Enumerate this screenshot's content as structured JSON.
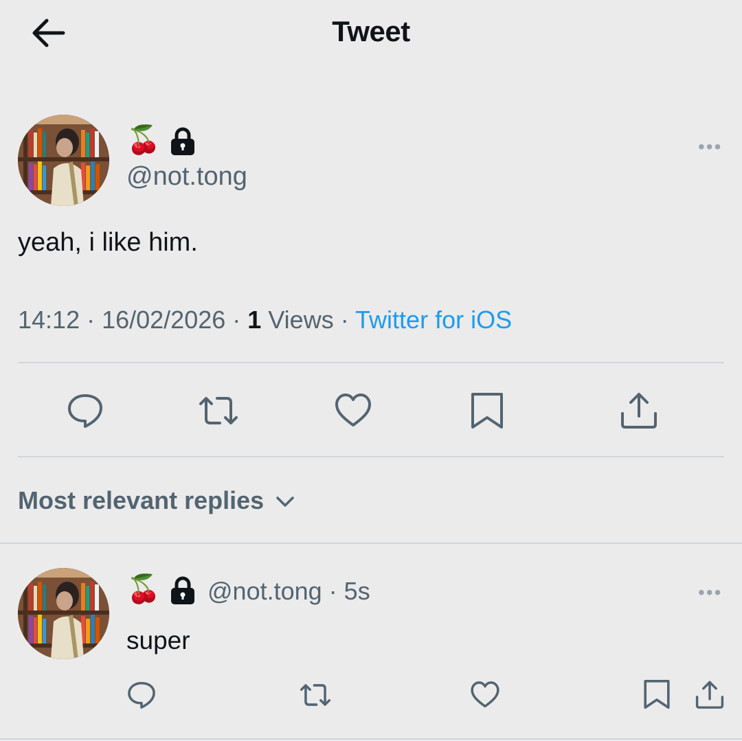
{
  "header": {
    "title": "Tweet",
    "back_icon": "arrow-left-icon"
  },
  "tweet": {
    "author_emoji": "🍒",
    "lock_icon": "lock-icon",
    "handle": "@not.tong",
    "text": "yeah, i like him.",
    "time": "14:12",
    "sep1": " · ",
    "date": "16/02/2026",
    "sep2": " · ",
    "views_count": "1",
    "views_label": " Views",
    "sep3": " · ",
    "source": "Twitter for iOS",
    "more_label": "•••"
  },
  "actions": [
    "reply-icon",
    "retweet-icon",
    "like-icon",
    "bookmark-icon",
    "share-icon"
  ],
  "replies_sort": {
    "label": "Most relevant replies",
    "icon": "chevron-down-icon"
  },
  "reply": {
    "author_emoji": "🍒",
    "handle": "@not.tong",
    "sep": " · ",
    "time": "5s",
    "text": "super",
    "more_label": "•••"
  },
  "colors": {
    "background": "#ebebeb",
    "text": "#0f1419",
    "secondary": "#536471",
    "link": "#1d9bf0",
    "divider": "#cfd6dc"
  }
}
